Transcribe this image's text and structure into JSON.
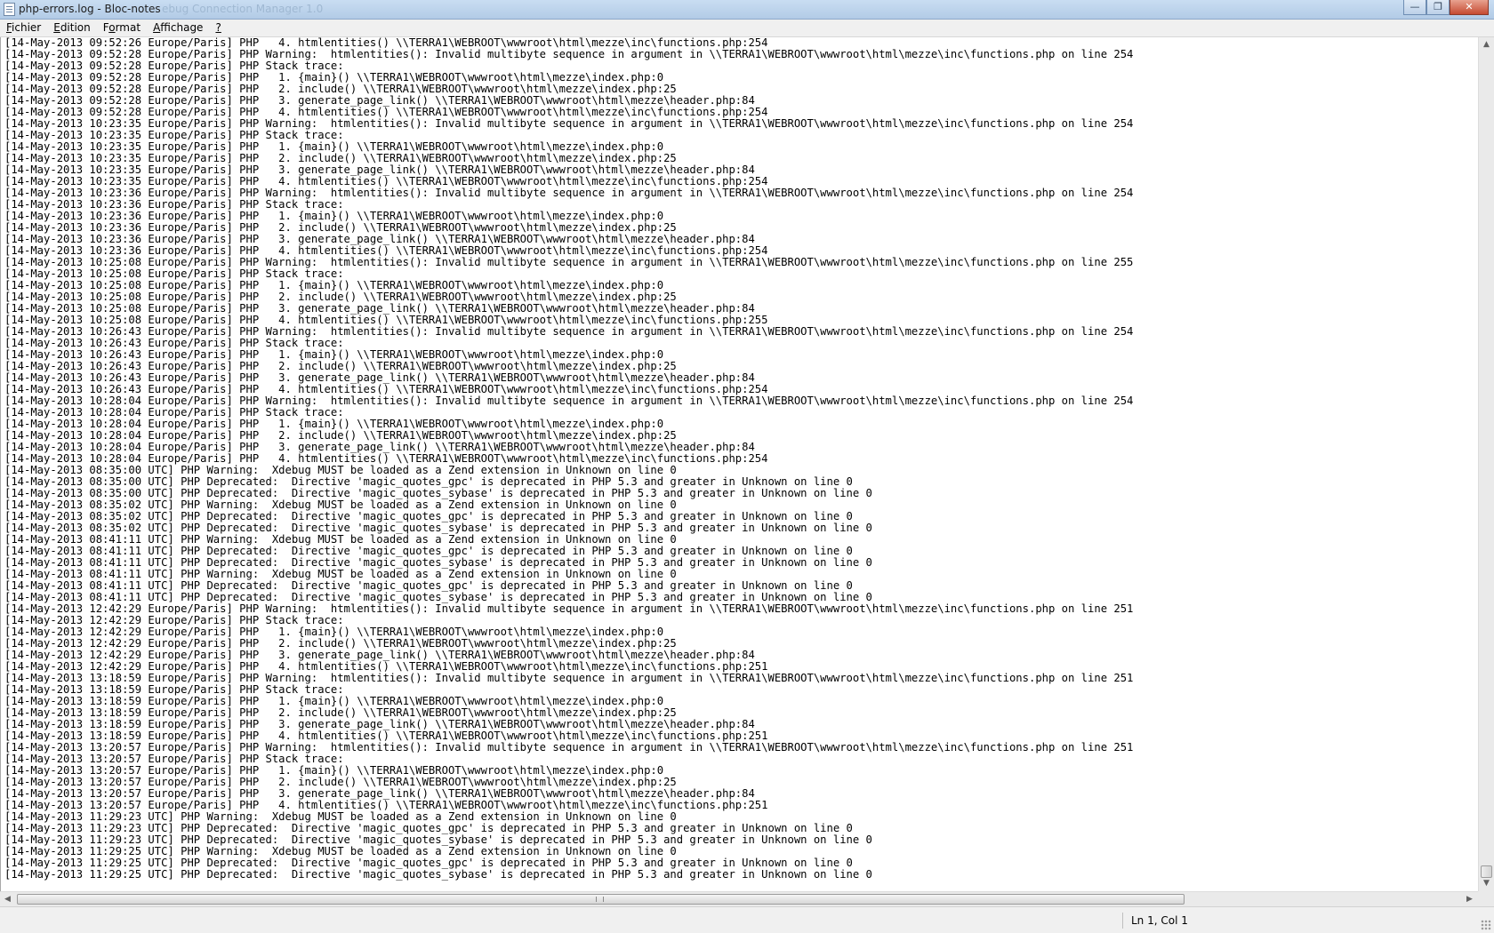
{
  "window": {
    "title": "php-errors.log - Bloc-notes",
    "ghost_title": "ebug Connection Manager 1.0",
    "minimize_label": "—",
    "maximize_label": "❐",
    "close_label": "✕"
  },
  "menu": [
    {
      "pre": "",
      "ul": "F",
      "post": "ichier"
    },
    {
      "pre": "",
      "ul": "E",
      "post": "dition"
    },
    {
      "pre": "F",
      "ul": "o",
      "post": "rmat"
    },
    {
      "pre": "",
      "ul": "A",
      "post": "ffichage"
    },
    {
      "pre": "",
      "ul": "?",
      "post": ""
    }
  ],
  "log_lines": [
    "[14-May-2013 09:52:26 Europe/Paris] PHP   4. htmlentities() \\\\TERRA1\\WEBROOT\\wwwroot\\html\\mezze\\inc\\functions.php:254",
    "[14-May-2013 09:52:28 Europe/Paris] PHP Warning:  htmlentities(): Invalid multibyte sequence in argument in \\\\TERRA1\\WEBROOT\\wwwroot\\html\\mezze\\inc\\functions.php on line 254",
    "[14-May-2013 09:52:28 Europe/Paris] PHP Stack trace:",
    "[14-May-2013 09:52:28 Europe/Paris] PHP   1. {main}() \\\\TERRA1\\WEBROOT\\wwwroot\\html\\mezze\\index.php:0",
    "[14-May-2013 09:52:28 Europe/Paris] PHP   2. include() \\\\TERRA1\\WEBROOT\\wwwroot\\html\\mezze\\index.php:25",
    "[14-May-2013 09:52:28 Europe/Paris] PHP   3. generate_page_link() \\\\TERRA1\\WEBROOT\\wwwroot\\html\\mezze\\header.php:84",
    "[14-May-2013 09:52:28 Europe/Paris] PHP   4. htmlentities() \\\\TERRA1\\WEBROOT\\wwwroot\\html\\mezze\\inc\\functions.php:254",
    "[14-May-2013 10:23:35 Europe/Paris] PHP Warning:  htmlentities(): Invalid multibyte sequence in argument in \\\\TERRA1\\WEBROOT\\wwwroot\\html\\mezze\\inc\\functions.php on line 254",
    "[14-May-2013 10:23:35 Europe/Paris] PHP Stack trace:",
    "[14-May-2013 10:23:35 Europe/Paris] PHP   1. {main}() \\\\TERRA1\\WEBROOT\\wwwroot\\html\\mezze\\index.php:0",
    "[14-May-2013 10:23:35 Europe/Paris] PHP   2. include() \\\\TERRA1\\WEBROOT\\wwwroot\\html\\mezze\\index.php:25",
    "[14-May-2013 10:23:35 Europe/Paris] PHP   3. generate_page_link() \\\\TERRA1\\WEBROOT\\wwwroot\\html\\mezze\\header.php:84",
    "[14-May-2013 10:23:35 Europe/Paris] PHP   4. htmlentities() \\\\TERRA1\\WEBROOT\\wwwroot\\html\\mezze\\inc\\functions.php:254",
    "[14-May-2013 10:23:36 Europe/Paris] PHP Warning:  htmlentities(): Invalid multibyte sequence in argument in \\\\TERRA1\\WEBROOT\\wwwroot\\html\\mezze\\inc\\functions.php on line 254",
    "[14-May-2013 10:23:36 Europe/Paris] PHP Stack trace:",
    "[14-May-2013 10:23:36 Europe/Paris] PHP   1. {main}() \\\\TERRA1\\WEBROOT\\wwwroot\\html\\mezze\\index.php:0",
    "[14-May-2013 10:23:36 Europe/Paris] PHP   2. include() \\\\TERRA1\\WEBROOT\\wwwroot\\html\\mezze\\index.php:25",
    "[14-May-2013 10:23:36 Europe/Paris] PHP   3. generate_page_link() \\\\TERRA1\\WEBROOT\\wwwroot\\html\\mezze\\header.php:84",
    "[14-May-2013 10:23:36 Europe/Paris] PHP   4. htmlentities() \\\\TERRA1\\WEBROOT\\wwwroot\\html\\mezze\\inc\\functions.php:254",
    "[14-May-2013 10:25:08 Europe/Paris] PHP Warning:  htmlentities(): Invalid multibyte sequence in argument in \\\\TERRA1\\WEBROOT\\wwwroot\\html\\mezze\\inc\\functions.php on line 255",
    "[14-May-2013 10:25:08 Europe/Paris] PHP Stack trace:",
    "[14-May-2013 10:25:08 Europe/Paris] PHP   1. {main}() \\\\TERRA1\\WEBROOT\\wwwroot\\html\\mezze\\index.php:0",
    "[14-May-2013 10:25:08 Europe/Paris] PHP   2. include() \\\\TERRA1\\WEBROOT\\wwwroot\\html\\mezze\\index.php:25",
    "[14-May-2013 10:25:08 Europe/Paris] PHP   3. generate_page_link() \\\\TERRA1\\WEBROOT\\wwwroot\\html\\mezze\\header.php:84",
    "[14-May-2013 10:25:08 Europe/Paris] PHP   4. htmlentities() \\\\TERRA1\\WEBROOT\\wwwroot\\html\\mezze\\inc\\functions.php:255",
    "[14-May-2013 10:26:43 Europe/Paris] PHP Warning:  htmlentities(): Invalid multibyte sequence in argument in \\\\TERRA1\\WEBROOT\\wwwroot\\html\\mezze\\inc\\functions.php on line 254",
    "[14-May-2013 10:26:43 Europe/Paris] PHP Stack trace:",
    "[14-May-2013 10:26:43 Europe/Paris] PHP   1. {main}() \\\\TERRA1\\WEBROOT\\wwwroot\\html\\mezze\\index.php:0",
    "[14-May-2013 10:26:43 Europe/Paris] PHP   2. include() \\\\TERRA1\\WEBROOT\\wwwroot\\html\\mezze\\index.php:25",
    "[14-May-2013 10:26:43 Europe/Paris] PHP   3. generate_page_link() \\\\TERRA1\\WEBROOT\\wwwroot\\html\\mezze\\header.php:84",
    "[14-May-2013 10:26:43 Europe/Paris] PHP   4. htmlentities() \\\\TERRA1\\WEBROOT\\wwwroot\\html\\mezze\\inc\\functions.php:254",
    "[14-May-2013 10:28:04 Europe/Paris] PHP Warning:  htmlentities(): Invalid multibyte sequence in argument in \\\\TERRA1\\WEBROOT\\wwwroot\\html\\mezze\\inc\\functions.php on line 254",
    "[14-May-2013 10:28:04 Europe/Paris] PHP Stack trace:",
    "[14-May-2013 10:28:04 Europe/Paris] PHP   1. {main}() \\\\TERRA1\\WEBROOT\\wwwroot\\html\\mezze\\index.php:0",
    "[14-May-2013 10:28:04 Europe/Paris] PHP   2. include() \\\\TERRA1\\WEBROOT\\wwwroot\\html\\mezze\\index.php:25",
    "[14-May-2013 10:28:04 Europe/Paris] PHP   3. generate_page_link() \\\\TERRA1\\WEBROOT\\wwwroot\\html\\mezze\\header.php:84",
    "[14-May-2013 10:28:04 Europe/Paris] PHP   4. htmlentities() \\\\TERRA1\\WEBROOT\\wwwroot\\html\\mezze\\inc\\functions.php:254",
    "[14-May-2013 08:35:00 UTC] PHP Warning:  Xdebug MUST be loaded as a Zend extension in Unknown on line 0",
    "[14-May-2013 08:35:00 UTC] PHP Deprecated:  Directive 'magic_quotes_gpc' is deprecated in PHP 5.3 and greater in Unknown on line 0",
    "[14-May-2013 08:35:00 UTC] PHP Deprecated:  Directive 'magic_quotes_sybase' is deprecated in PHP 5.3 and greater in Unknown on line 0",
    "[14-May-2013 08:35:02 UTC] PHP Warning:  Xdebug MUST be loaded as a Zend extension in Unknown on line 0",
    "[14-May-2013 08:35:02 UTC] PHP Deprecated:  Directive 'magic_quotes_gpc' is deprecated in PHP 5.3 and greater in Unknown on line 0",
    "[14-May-2013 08:35:02 UTC] PHP Deprecated:  Directive 'magic_quotes_sybase' is deprecated in PHP 5.3 and greater in Unknown on line 0",
    "[14-May-2013 08:41:11 UTC] PHP Warning:  Xdebug MUST be loaded as a Zend extension in Unknown on line 0",
    "[14-May-2013 08:41:11 UTC] PHP Deprecated:  Directive 'magic_quotes_gpc' is deprecated in PHP 5.3 and greater in Unknown on line 0",
    "[14-May-2013 08:41:11 UTC] PHP Deprecated:  Directive 'magic_quotes_sybase' is deprecated in PHP 5.3 and greater in Unknown on line 0",
    "[14-May-2013 08:41:11 UTC] PHP Warning:  Xdebug MUST be loaded as a Zend extension in Unknown on line 0",
    "[14-May-2013 08:41:11 UTC] PHP Deprecated:  Directive 'magic_quotes_gpc' is deprecated in PHP 5.3 and greater in Unknown on line 0",
    "[14-May-2013 08:41:11 UTC] PHP Deprecated:  Directive 'magic_quotes_sybase' is deprecated in PHP 5.3 and greater in Unknown on line 0",
    "[14-May-2013 12:42:29 Europe/Paris] PHP Warning:  htmlentities(): Invalid multibyte sequence in argument in \\\\TERRA1\\WEBROOT\\wwwroot\\html\\mezze\\inc\\functions.php on line 251",
    "[14-May-2013 12:42:29 Europe/Paris] PHP Stack trace:",
    "[14-May-2013 12:42:29 Europe/Paris] PHP   1. {main}() \\\\TERRA1\\WEBROOT\\wwwroot\\html\\mezze\\index.php:0",
    "[14-May-2013 12:42:29 Europe/Paris] PHP   2. include() \\\\TERRA1\\WEBROOT\\wwwroot\\html\\mezze\\index.php:25",
    "[14-May-2013 12:42:29 Europe/Paris] PHP   3. generate_page_link() \\\\TERRA1\\WEBROOT\\wwwroot\\html\\mezze\\header.php:84",
    "[14-May-2013 12:42:29 Europe/Paris] PHP   4. htmlentities() \\\\TERRA1\\WEBROOT\\wwwroot\\html\\mezze\\inc\\functions.php:251",
    "[14-May-2013 13:18:59 Europe/Paris] PHP Warning:  htmlentities(): Invalid multibyte sequence in argument in \\\\TERRA1\\WEBROOT\\wwwroot\\html\\mezze\\inc\\functions.php on line 251",
    "[14-May-2013 13:18:59 Europe/Paris] PHP Stack trace:",
    "[14-May-2013 13:18:59 Europe/Paris] PHP   1. {main}() \\\\TERRA1\\WEBROOT\\wwwroot\\html\\mezze\\index.php:0",
    "[14-May-2013 13:18:59 Europe/Paris] PHP   2. include() \\\\TERRA1\\WEBROOT\\wwwroot\\html\\mezze\\index.php:25",
    "[14-May-2013 13:18:59 Europe/Paris] PHP   3. generate_page_link() \\\\TERRA1\\WEBROOT\\wwwroot\\html\\mezze\\header.php:84",
    "[14-May-2013 13:18:59 Europe/Paris] PHP   4. htmlentities() \\\\TERRA1\\WEBROOT\\wwwroot\\html\\mezze\\inc\\functions.php:251",
    "[14-May-2013 13:20:57 Europe/Paris] PHP Warning:  htmlentities(): Invalid multibyte sequence in argument in \\\\TERRA1\\WEBROOT\\wwwroot\\html\\mezze\\inc\\functions.php on line 251",
    "[14-May-2013 13:20:57 Europe/Paris] PHP Stack trace:",
    "[14-May-2013 13:20:57 Europe/Paris] PHP   1. {main}() \\\\TERRA1\\WEBROOT\\wwwroot\\html\\mezze\\index.php:0",
    "[14-May-2013 13:20:57 Europe/Paris] PHP   2. include() \\\\TERRA1\\WEBROOT\\wwwroot\\html\\mezze\\index.php:25",
    "[14-May-2013 13:20:57 Europe/Paris] PHP   3. generate_page_link() \\\\TERRA1\\WEBROOT\\wwwroot\\html\\mezze\\header.php:84",
    "[14-May-2013 13:20:57 Europe/Paris] PHP   4. htmlentities() \\\\TERRA1\\WEBROOT\\wwwroot\\html\\mezze\\inc\\functions.php:251",
    "[14-May-2013 11:29:23 UTC] PHP Warning:  Xdebug MUST be loaded as a Zend extension in Unknown on line 0",
    "[14-May-2013 11:29:23 UTC] PHP Deprecated:  Directive 'magic_quotes_gpc' is deprecated in PHP 5.3 and greater in Unknown on line 0",
    "[14-May-2013 11:29:23 UTC] PHP Deprecated:  Directive 'magic_quotes_sybase' is deprecated in PHP 5.3 and greater in Unknown on line 0",
    "[14-May-2013 11:29:25 UTC] PHP Warning:  Xdebug MUST be loaded as a Zend extension in Unknown on line 0",
    "[14-May-2013 11:29:25 UTC] PHP Deprecated:  Directive 'magic_quotes_gpc' is deprecated in PHP 5.3 and greater in Unknown on line 0",
    "[14-May-2013 11:29:25 UTC] PHP Deprecated:  Directive 'magic_quotes_sybase' is deprecated in PHP 5.3 and greater in Unknown on line 0"
  ],
  "scrollbars": {
    "up_arrow": "▲",
    "down_arrow": "▼",
    "left_arrow": "◀",
    "right_arrow": "▶"
  },
  "status": {
    "position": "Ln 1, Col 1"
  }
}
